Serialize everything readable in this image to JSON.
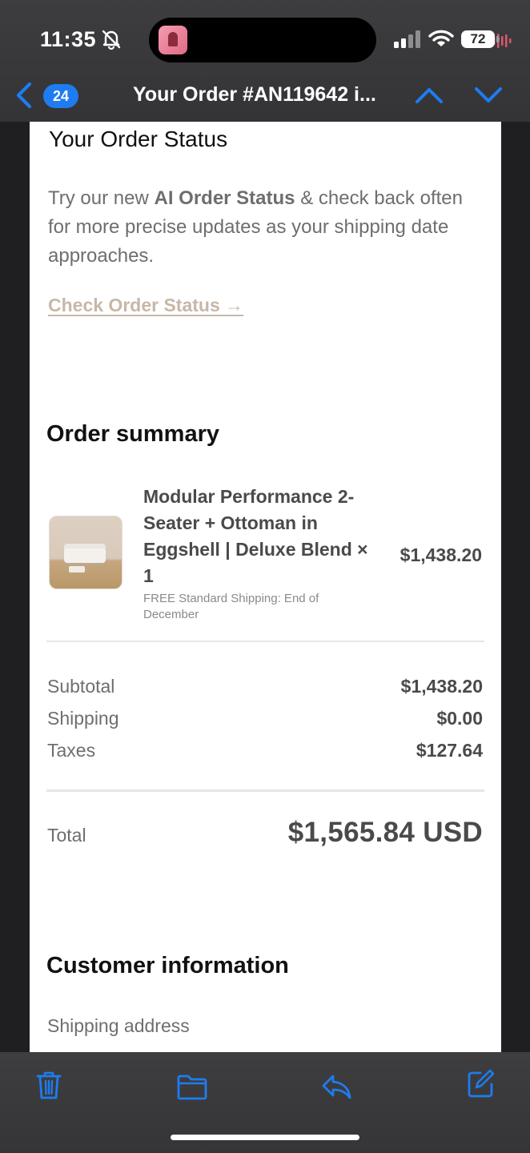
{
  "status_bar": {
    "time": "11:35",
    "battery": "72"
  },
  "nav": {
    "back_count": "24",
    "title": "Your Order #AN119642 i..."
  },
  "order_status": {
    "heading": "Your Order Status",
    "body_prefix": "Try our new ",
    "body_bold": "AI Order Status",
    "body_suffix": " & check back often for more precise updates as your shipping date approaches.",
    "link": "Check Order Status →"
  },
  "order_summary": {
    "heading": "Order summary",
    "item": {
      "name": "Modular Performance 2-Seater + Ottoman in Eggshell | Deluxe Blend × 1",
      "note": "FREE Standard Shipping: End of December",
      "price": "$1,438.20"
    },
    "lines": [
      {
        "label": "Subtotal",
        "value": "$1,438.20"
      },
      {
        "label": "Shipping",
        "value": "$0.00"
      },
      {
        "label": "Taxes",
        "value": "$127.64"
      }
    ],
    "total_label": "Total",
    "total_value": "$1,565.84 USD"
  },
  "customer": {
    "heading": "Customer information",
    "shipping_label": "Shipping address"
  },
  "colors": {
    "accent": "#1e7cf0",
    "link": "#c8b7a8"
  },
  "icons": {
    "toolbar": [
      "trash-icon",
      "folder-icon",
      "reply-icon",
      "compose-icon"
    ]
  }
}
